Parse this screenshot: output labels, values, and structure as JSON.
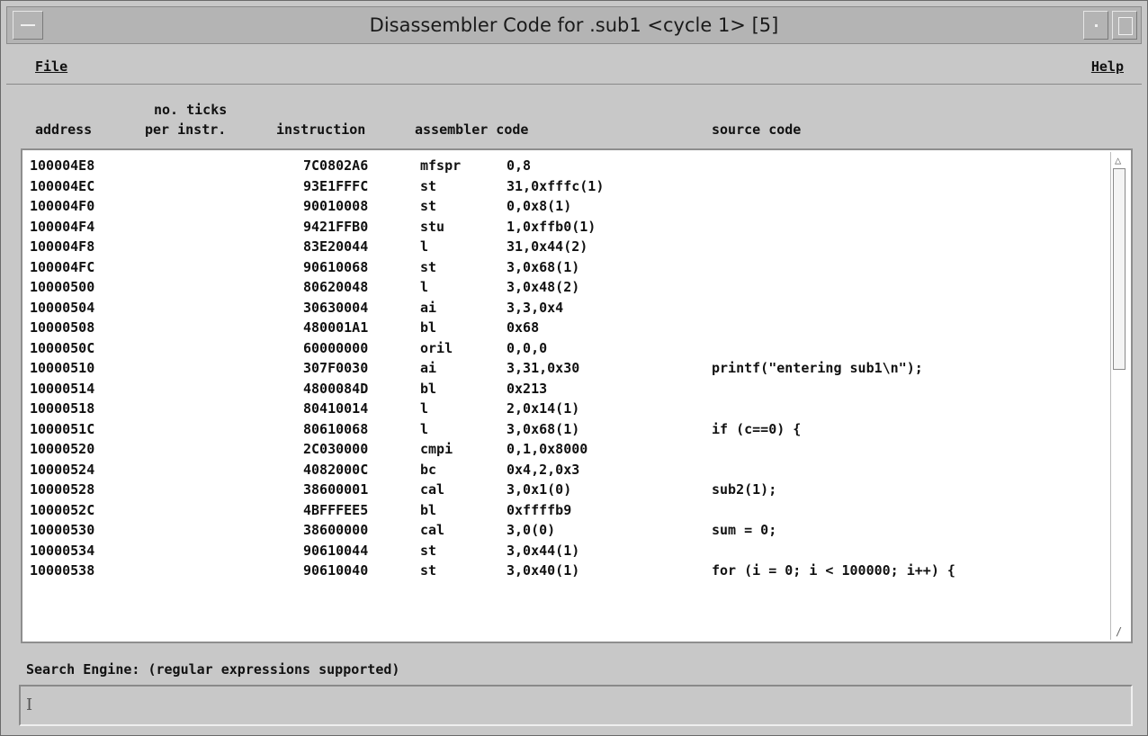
{
  "window": {
    "title": "Disassembler Code for .sub1 <cycle 1> [5]"
  },
  "menu": {
    "file": "File",
    "help": "Help"
  },
  "headers": {
    "address": "address",
    "ticks_line1": "no. ticks",
    "ticks_line2": "per instr.",
    "instruction": "instruction",
    "assembler": "assembler code",
    "source": "source code"
  },
  "rows": [
    {
      "address": "100004E8",
      "ticks": "",
      "instruction": "7C0802A6",
      "op": "mfspr",
      "args": "0,8",
      "source": ""
    },
    {
      "address": "100004EC",
      "ticks": "",
      "instruction": "93E1FFFC",
      "op": "st",
      "args": "31,0xfffc(1)",
      "source": ""
    },
    {
      "address": "100004F0",
      "ticks": "",
      "instruction": "90010008",
      "op": "st",
      "args": "0,0x8(1)",
      "source": ""
    },
    {
      "address": "100004F4",
      "ticks": "",
      "instruction": "9421FFB0",
      "op": "stu",
      "args": "1,0xffb0(1)",
      "source": ""
    },
    {
      "address": "100004F8",
      "ticks": "",
      "instruction": "83E20044",
      "op": "l",
      "args": "31,0x44(2)",
      "source": ""
    },
    {
      "address": "100004FC",
      "ticks": "",
      "instruction": "90610068",
      "op": "st",
      "args": "3,0x68(1)",
      "source": ""
    },
    {
      "address": "10000500",
      "ticks": "",
      "instruction": "80620048",
      "op": "l",
      "args": "3,0x48(2)",
      "source": ""
    },
    {
      "address": "10000504",
      "ticks": "",
      "instruction": "30630004",
      "op": "ai",
      "args": "3,3,0x4",
      "source": ""
    },
    {
      "address": "10000508",
      "ticks": "",
      "instruction": "480001A1",
      "op": "bl",
      "args": "0x68",
      "source": ""
    },
    {
      "address": "1000050C",
      "ticks": "",
      "instruction": "60000000",
      "op": "oril",
      "args": "0,0,0",
      "source": ""
    },
    {
      "address": "10000510",
      "ticks": "",
      "instruction": "307F0030",
      "op": "ai",
      "args": "3,31,0x30",
      "source": "printf(\"entering sub1\\n\");"
    },
    {
      "address": "10000514",
      "ticks": "",
      "instruction": "4800084D",
      "op": "bl",
      "args": "0x213",
      "source": ""
    },
    {
      "address": "10000518",
      "ticks": "",
      "instruction": "80410014",
      "op": "l",
      "args": "2,0x14(1)",
      "source": ""
    },
    {
      "address": "1000051C",
      "ticks": "",
      "instruction": "80610068",
      "op": "l",
      "args": "3,0x68(1)",
      "source": "if (c==0) {"
    },
    {
      "address": "10000520",
      "ticks": "",
      "instruction": "2C030000",
      "op": "cmpi",
      "args": "0,1,0x8000",
      "source": ""
    },
    {
      "address": "10000524",
      "ticks": "",
      "instruction": "4082000C",
      "op": "bc",
      "args": "0x4,2,0x3",
      "source": ""
    },
    {
      "address": "10000528",
      "ticks": "",
      "instruction": "38600001",
      "op": "cal",
      "args": "3,0x1(0)",
      "source": "sub2(1);"
    },
    {
      "address": "1000052C",
      "ticks": "",
      "instruction": "4BFFFEE5",
      "op": "bl",
      "args": "0xffffb9",
      "source": ""
    },
    {
      "address": "10000530",
      "ticks": "",
      "instruction": "38600000",
      "op": "cal",
      "args": "3,0(0)",
      "source": "sum = 0;"
    },
    {
      "address": "10000534",
      "ticks": "",
      "instruction": "90610044",
      "op": "st",
      "args": "3,0x44(1)",
      "source": ""
    },
    {
      "address": "10000538",
      "ticks": "",
      "instruction": "90610040",
      "op": "st",
      "args": "3,0x40(1)",
      "source": "for (i = 0; i < 100000; i++) {"
    }
  ],
  "search": {
    "label": "Search Engine: (regular expressions supported)",
    "value": ""
  }
}
